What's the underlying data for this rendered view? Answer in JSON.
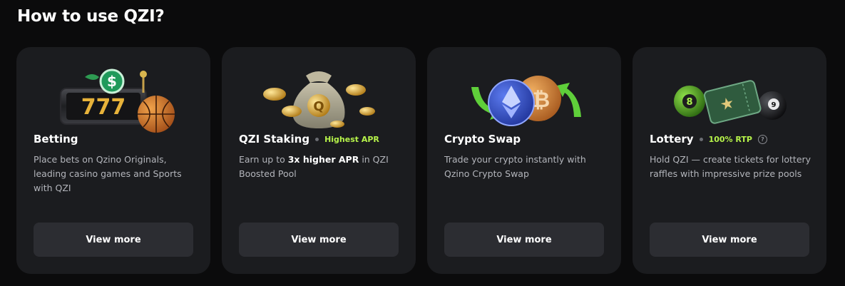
{
  "section": {
    "title": "How to use QZI?"
  },
  "cards": [
    {
      "title": "Betting",
      "badge": "",
      "desc": "Place bets on Qzino Originals, leading casino games and Sports with QZI",
      "button_label": "View more"
    },
    {
      "title": "QZI Staking",
      "badge": "Highest APR",
      "desc_prefix": "Earn up to ",
      "desc_bold": "3x higher APR",
      "desc_suffix": " in QZI Boosted Pool",
      "button_label": "View more"
    },
    {
      "title": "Crypto Swap",
      "badge": "",
      "desc": "Trade your crypto instantly with Qzino Crypto Swap",
      "button_label": "View more"
    },
    {
      "title": "Lottery",
      "badge": "100% RTP",
      "help": "?",
      "desc": "Hold QZI — create tickets for lottery raffles with impressive prize pools",
      "button_label": "View more"
    }
  ],
  "illustrations": {
    "slot_digits": "777",
    "cash_symbol": "$",
    "bag_letter": "Q",
    "coin_letter": "Q",
    "btc_symbol": "₿",
    "ball_left": "8",
    "ball_right": "9",
    "ticket_symbol": "★"
  },
  "colors": {
    "background": "#0b0b0c",
    "card": "#1b1c1f",
    "button": "#2c2d32",
    "badge": "#b6f34a",
    "muted_text": "#b3b5bb"
  }
}
